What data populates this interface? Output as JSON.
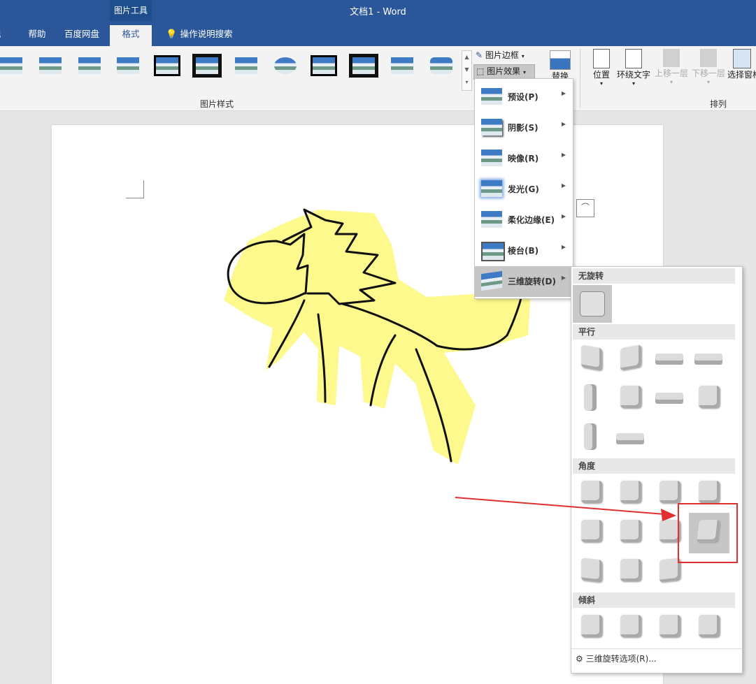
{
  "window": {
    "title": "文档1  -  Word",
    "context_group": "图片工具"
  },
  "tabs": [
    {
      "label": "视图"
    },
    {
      "label": "帮助"
    },
    {
      "label": "百度网盘"
    },
    {
      "label": "格式"
    },
    {
      "label": "操作说明搜索"
    }
  ],
  "ribbon": {
    "picture_border": "图片边框",
    "picture_effects": "图片效果",
    "replace": "替换",
    "position": "位置",
    "wrap_text": "环绕文字",
    "bring_forward": "上移一层",
    "send_backward": "下移一层",
    "selection_pane": "选择窗格",
    "picture_styles_group": "图片样式",
    "arrange_group": "排列"
  },
  "effects_menu": {
    "items": [
      {
        "label": "预设(P)"
      },
      {
        "label": "阴影(S)"
      },
      {
        "label": "映像(R)"
      },
      {
        "label": "发光(G)"
      },
      {
        "label": "柔化边缘(E)"
      },
      {
        "label": "棱台(B)"
      },
      {
        "label": "三维旋转(D)"
      }
    ]
  },
  "rotation_gallery": {
    "sections": {
      "none": "无旋转",
      "parallel": "平行",
      "perspective": "角度",
      "oblique": "倾斜"
    },
    "footer": "三维旋转选项(R)..."
  },
  "colors": {
    "titlebar": "#2b579a",
    "highlight": "#e03030",
    "doodle_fill": "#fdf98c"
  }
}
